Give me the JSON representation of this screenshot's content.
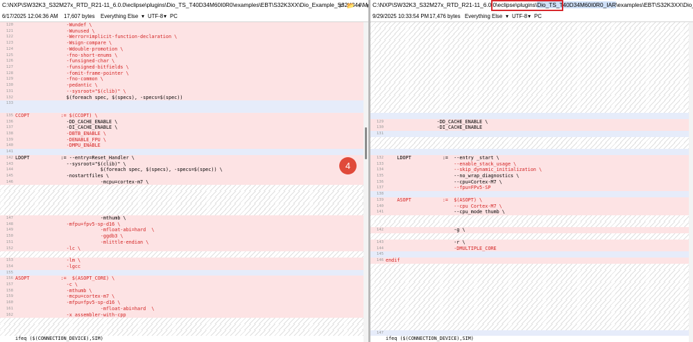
{
  "left": {
    "path": "C:\\NXP\\SW32K3_S32M27x_RTD_R21-11_6.0.0\\eclipse\\plugins\\Dio_TS_T40D34M60I0R0\\examples\\EBT\\S32K3XX\\Dio_Example_S32K344\\Makefile",
    "info": {
      "date": "6/17/2025 12:04:36 AM",
      "size": "17,607 bytes",
      "filter": "Everything Else",
      "encoding": "UTF-8",
      "eol": "PC"
    },
    "rows": [
      {
        "n": "120",
        "t": "                  -Wundef \\",
        "c": "red",
        "bg": "diff"
      },
      {
        "n": "121",
        "t": "                  -Wunused \\",
        "c": "red",
        "bg": "diff"
      },
      {
        "n": "122",
        "t": "                  -Werror=implicit-function-declaration \\",
        "c": "red",
        "bg": "diff"
      },
      {
        "n": "123",
        "t": "                  -Wsign-compare \\",
        "c": "red",
        "bg": "diff"
      },
      {
        "n": "124",
        "t": "                  -Wdouble-promotion \\",
        "c": "red",
        "bg": "diff"
      },
      {
        "n": "125",
        "t": "                  -fno-short-enums \\",
        "c": "red",
        "bg": "diff"
      },
      {
        "n": "126",
        "t": "                  -funsigned-char \\",
        "c": "red",
        "bg": "diff"
      },
      {
        "n": "127",
        "t": "                  -funsigned-bitfields \\",
        "c": "red",
        "bg": "diff"
      },
      {
        "n": "128",
        "t": "                  -fomit-frame-pointer \\",
        "c": "red",
        "bg": "diff"
      },
      {
        "n": "129",
        "t": "                  -fno-common \\",
        "c": "red",
        "bg": "diff"
      },
      {
        "n": "130",
        "t": "                  -pedantic \\",
        "c": "red",
        "bg": "diff"
      },
      {
        "n": "131",
        "t": "                  --sysroot=\"$(clib)\" \\",
        "c": "red",
        "bg": "diff"
      },
      {
        "n": "132",
        "t": "                  $(foreach spec, $(specs), -specs=$(spec))",
        "c": "black",
        "bg": "diff"
      },
      {
        "n": "133",
        "t": "",
        "c": "black",
        "bg": "sep"
      },
      {
        "n": "",
        "t": "",
        "c": "black",
        "bg": "sep2"
      },
      {
        "n": "135",
        "t": "CCOPT           := $(CCOPT) \\",
        "c": "red",
        "bg": "diff"
      },
      {
        "n": "136",
        "t": "                  -DD_CACHE_ENABLE \\",
        "c": "black",
        "bg": "diff"
      },
      {
        "n": "137",
        "t": "                  -DI_CACHE_ENABLE \\",
        "c": "black",
        "bg": "diff"
      },
      {
        "n": "138",
        "t": "                  -DBTB_ENABLE \\",
        "c": "red",
        "bg": "diff"
      },
      {
        "n": "139",
        "t": "                  -DENABLE_FPU \\",
        "c": "red",
        "bg": "diff"
      },
      {
        "n": "140",
        "t": "                  -DMPU_ENABLE",
        "c": "red",
        "bg": "diff"
      },
      {
        "n": "141",
        "t": "",
        "c": "black",
        "bg": "sep"
      },
      {
        "n": "142",
        "t": "LDOPT           := --entry=Reset_Handler \\",
        "c": "black",
        "bg": "diff"
      },
      {
        "n": "143",
        "t": "                  --sysroot=\"$(clib)\" \\",
        "c": "black",
        "bg": "diff"
      },
      {
        "n": "144",
        "t": "                              $(foreach spec, $(specs), -specs=$(spec)) \\",
        "c": "black",
        "bg": "diff"
      },
      {
        "n": "145",
        "t": "                  -nostartfiles \\",
        "c": "black",
        "bg": "diff"
      },
      {
        "n": "146",
        "t": "                              -mcpu=cortex-m7 \\",
        "c": "black",
        "bg": "diff"
      },
      {
        "n": "",
        "t": "",
        "c": "black",
        "bg": "gap"
      },
      {
        "n": "",
        "t": "",
        "c": "black",
        "bg": "gap"
      },
      {
        "n": "",
        "t": "",
        "c": "black",
        "bg": "gap"
      },
      {
        "n": "",
        "t": "",
        "c": "black",
        "bg": "gap"
      },
      {
        "n": "",
        "t": "",
        "c": "black",
        "bg": "gap"
      },
      {
        "n": "147",
        "t": "                              -mthumb \\",
        "c": "black",
        "bg": "diff"
      },
      {
        "n": "148",
        "t": "                  -mfpu=fpv5-sp-d16 \\",
        "c": "red",
        "bg": "diff"
      },
      {
        "n": "149",
        "t": "                              -mfloat-abi=hard  \\",
        "c": "red",
        "bg": "diff"
      },
      {
        "n": "150",
        "t": "                              -ggdb3 \\",
        "c": "red",
        "bg": "diff"
      },
      {
        "n": "151",
        "t": "                              -mlittle-endian \\",
        "c": "red",
        "bg": "diff"
      },
      {
        "n": "152",
        "t": "                  -lc \\",
        "c": "red",
        "bg": "diff"
      },
      {
        "n": "",
        "t": "",
        "c": "black",
        "bg": "gap"
      },
      {
        "n": "153",
        "t": "                  -lm \\",
        "c": "red",
        "bg": "diff"
      },
      {
        "n": "154",
        "t": "                  -lgcc",
        "c": "red",
        "bg": "diff"
      },
      {
        "n": "155",
        "t": "",
        "c": "black",
        "bg": "sep"
      },
      {
        "n": "156",
        "t": "ASOPT           :=  $(ASOPT_CORE) \\",
        "c": "red",
        "bg": "diff"
      },
      {
        "n": "157",
        "t": "                  -c \\",
        "c": "red",
        "bg": "diff"
      },
      {
        "n": "158",
        "t": "                  -mthumb \\",
        "c": "red",
        "bg": "diff"
      },
      {
        "n": "159",
        "t": "                  -mcpu=cortex-m7 \\",
        "c": "red",
        "bg": "diff"
      },
      {
        "n": "160",
        "t": "                  -mfpu=fpv5-sp-d16 \\",
        "c": "red",
        "bg": "diff"
      },
      {
        "n": "161",
        "t": "                              -mfloat-abi=hard  \\",
        "c": "red",
        "bg": "diff"
      },
      {
        "n": "162",
        "t": "                  -x assembler-with-cpp",
        "c": "red",
        "bg": "diff"
      },
      {
        "n": "",
        "t": "",
        "c": "black",
        "bg": "gap"
      },
      {
        "n": "",
        "t": "",
        "c": "black",
        "bg": "gap"
      },
      {
        "n": "",
        "t": "",
        "c": "black",
        "bg": "gap"
      },
      {
        "n": "",
        "t": "ifeq ($(CONNECTION_DEVICE),SIM)",
        "c": "black",
        "bg": "plain"
      }
    ]
  },
  "right": {
    "path_before": "C:\\NXP\\SW32K3_S32M27x_RTD_R21-11_6.0.0\\eclipse\\plugins\\",
    "path_highlight": "Dio_TS_T40D34M60I0R0_IAR",
    "path_after": "\\examples\\EBT\\S32K3XX\\Dio_Example_S32K344\\Makefile",
    "info": {
      "date": "9/29/2025 10:33:54 PM",
      "size": "17,476 bytes",
      "filter": "Everything Else",
      "encoding": "UTF-8",
      "eol": "PC"
    },
    "rows": [
      {
        "n": "",
        "t": "",
        "c": "black",
        "bg": "gap"
      },
      {
        "n": "",
        "t": "",
        "c": "black",
        "bg": "gap"
      },
      {
        "n": "",
        "t": "",
        "c": "black",
        "bg": "gap"
      },
      {
        "n": "",
        "t": "",
        "c": "black",
        "bg": "gap"
      },
      {
        "n": "",
        "t": "",
        "c": "black",
        "bg": "gap"
      },
      {
        "n": "",
        "t": "",
        "c": "black",
        "bg": "gap"
      },
      {
        "n": "",
        "t": "",
        "c": "black",
        "bg": "gap"
      },
      {
        "n": "",
        "t": "",
        "c": "black",
        "bg": "gap"
      },
      {
        "n": "",
        "t": "",
        "c": "black",
        "bg": "gap"
      },
      {
        "n": "",
        "t": "",
        "c": "black",
        "bg": "gap"
      },
      {
        "n": "",
        "t": "",
        "c": "black",
        "bg": "gap"
      },
      {
        "n": "",
        "t": "",
        "c": "black",
        "bg": "gap"
      },
      {
        "n": "",
        "t": "",
        "c": "black",
        "bg": "gap"
      },
      {
        "n": "",
        "t": "",
        "c": "black",
        "bg": "gap"
      },
      {
        "n": "",
        "t": "",
        "c": "black",
        "bg": "gap"
      },
      {
        "n": "",
        "t": "",
        "c": "black",
        "bg": "sep2"
      },
      {
        "n": "129",
        "t": "                  -DD_CACHE_ENABLE \\",
        "c": "black",
        "bg": "diff"
      },
      {
        "n": "130",
        "t": "                  -DI_CACHE_ENABLE",
        "c": "black",
        "bg": "diff"
      },
      {
        "n": "131",
        "t": "",
        "c": "black",
        "bg": "sep"
      },
      {
        "n": "",
        "t": "",
        "c": "black",
        "bg": "gap"
      },
      {
        "n": "",
        "t": "",
        "c": "black",
        "bg": "gap"
      },
      {
        "n": "",
        "t": "",
        "c": "black",
        "bg": "sep"
      },
      {
        "n": "132",
        "t": "    LDOPT           :=  --entry _start \\",
        "c": "black",
        "bg": "diff"
      },
      {
        "n": "133",
        "t": "                        --enable_stack_usage \\",
        "c": "red",
        "bg": "diff"
      },
      {
        "n": "134",
        "t": "                        --skip_dynamic_initialization \\",
        "c": "red",
        "bg": "diff"
      },
      {
        "n": "135",
        "t": "                        --no_wrap_diagnostics \\",
        "c": "black",
        "bg": "diff"
      },
      {
        "n": "136",
        "t": "                        --cpu=Cortex-M7 \\",
        "c": "black",
        "bg": "diff"
      },
      {
        "n": "137",
        "t": "                        --fpu=FPv5-SP",
        "c": "red",
        "bg": "diff"
      },
      {
        "n": "138",
        "t": "",
        "c": "black",
        "bg": "sep"
      },
      {
        "n": "139",
        "t": "    ASOPT           :=  $(ASOPT) \\",
        "c": "red",
        "bg": "diff"
      },
      {
        "n": "140",
        "t": "                        --cpu Cortex-M7 \\",
        "c": "red",
        "bg": "diff"
      },
      {
        "n": "141",
        "t": "                        --cpu_mode thumb \\",
        "c": "black",
        "bg": "diff"
      },
      {
        "n": "",
        "t": "",
        "c": "black",
        "bg": "gap"
      },
      {
        "n": "",
        "t": "",
        "c": "black",
        "bg": "gap"
      },
      {
        "n": "142",
        "t": "                        -g \\",
        "c": "black",
        "bg": "diff"
      },
      {
        "n": "",
        "t": "",
        "c": "black",
        "bg": "gap"
      },
      {
        "n": "143",
        "t": "                        -r \\",
        "c": "black",
        "bg": "diff"
      },
      {
        "n": "144",
        "t": "                        -DMULTIPLE_CORE",
        "c": "red",
        "bg": "diff"
      },
      {
        "n": "145",
        "t": "",
        "c": "black",
        "bg": "sep"
      },
      {
        "n": "146",
        "t": "endif",
        "c": "red",
        "bg": "diff"
      },
      {
        "n": "",
        "t": "",
        "c": "black",
        "bg": "gap"
      },
      {
        "n": "",
        "t": "",
        "c": "black",
        "bg": "gap"
      },
      {
        "n": "",
        "t": "",
        "c": "black",
        "bg": "gap"
      },
      {
        "n": "",
        "t": "",
        "c": "black",
        "bg": "gap"
      },
      {
        "n": "",
        "t": "",
        "c": "black",
        "bg": "gap"
      },
      {
        "n": "",
        "t": "",
        "c": "black",
        "bg": "gap"
      },
      {
        "n": "",
        "t": "",
        "c": "black",
        "bg": "gap"
      },
      {
        "n": "",
        "t": "",
        "c": "black",
        "bg": "gap"
      },
      {
        "n": "",
        "t": "",
        "c": "black",
        "bg": "gap"
      },
      {
        "n": "",
        "t": "",
        "c": "black",
        "bg": "gap"
      },
      {
        "n": "",
        "t": "",
        "c": "black",
        "bg": "gap"
      },
      {
        "n": "147",
        "t": "",
        "c": "black",
        "bg": "sep"
      },
      {
        "n": "",
        "t": "ifeq ($(CONNECTION_DEVICE),SIM)",
        "c": "black",
        "bg": "plain"
      }
    ]
  },
  "badge": "4",
  "icons": {
    "browse": "folder-icon",
    "save": "save-icon",
    "dropdown": "chevron-down-icon",
    "nav": "arrow-icon"
  },
  "colors": {
    "diff_bg": "#fde3e4",
    "diff_text": "#d21f1f",
    "highlight_box": "#d7262b",
    "badge": "#e04a3a"
  }
}
